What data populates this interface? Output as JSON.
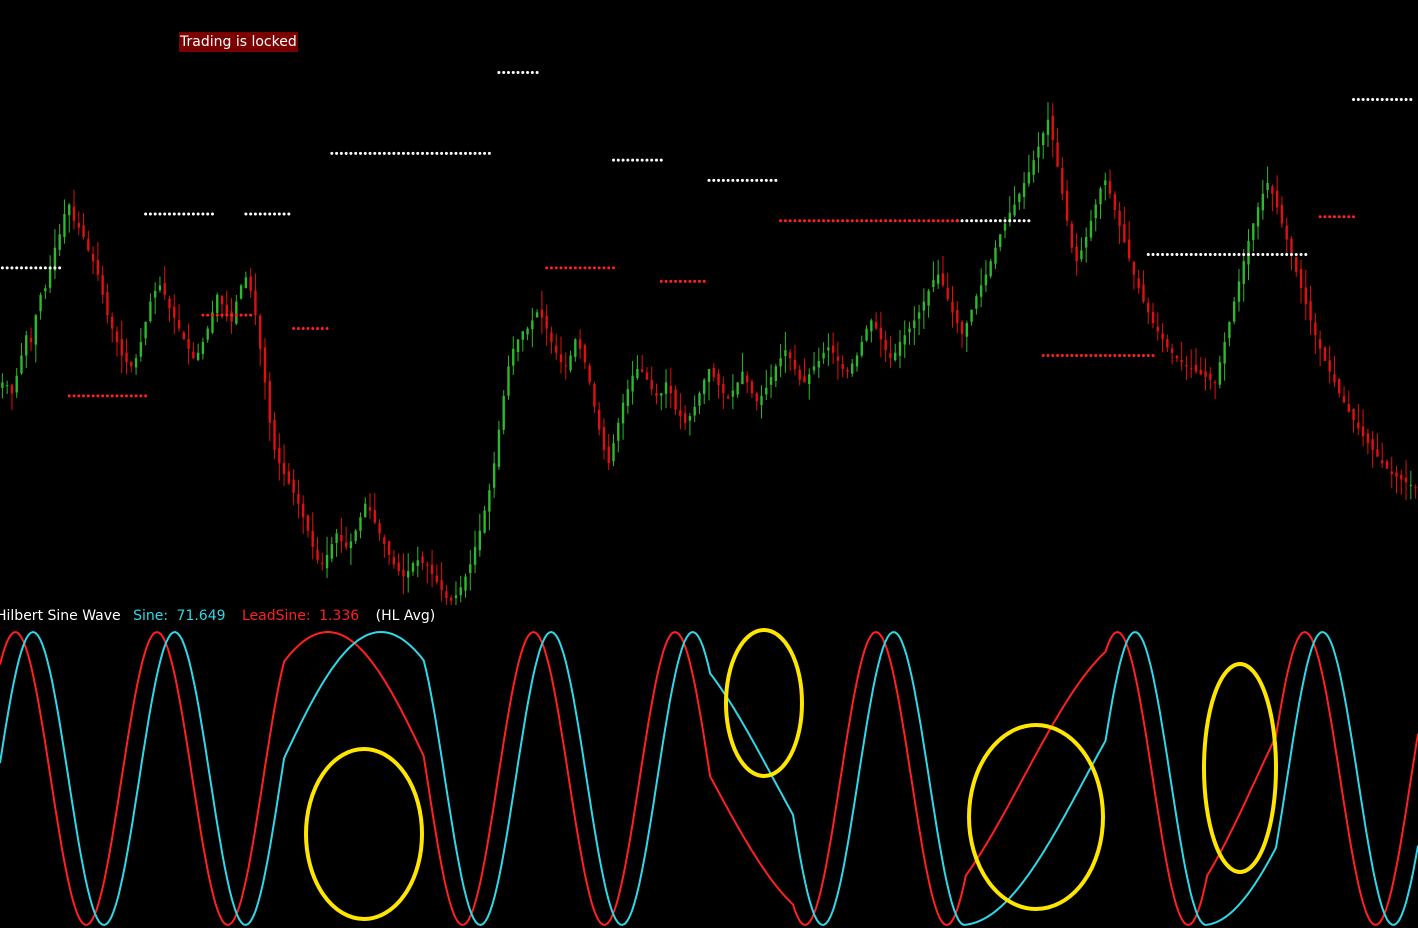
{
  "status": {
    "trading_lock": "Trading is locked"
  },
  "indicator": {
    "name": "Hilbert Sine Wave",
    "sine_label": "Sine:",
    "sine_value": "71.649",
    "leadsine_label": "LeadSine:",
    "leadsine_value": "1.336",
    "price_source": "(HL Avg)"
  },
  "colors": {
    "background": "#000000",
    "bull_candle": "#2db82d",
    "bear_candle": "#e01010",
    "resistance_dots": "#ffffff",
    "support_dots": "#ff2020",
    "sine_line": "#2fd8e8",
    "leadsine_line": "#ff2020",
    "highlight_circle": "#ffe600",
    "lock_label_bg": "#7a0000"
  },
  "chart_data": [
    {
      "type": "candlestick",
      "title": "",
      "description_series": "price path",
      "close": [
        380,
        378,
        372,
        385,
        400,
        415,
        410,
        430,
        445,
        450,
        465,
        480,
        490,
        505,
        512,
        500,
        495,
        488,
        478,
        470,
        460,
        445,
        430,
        420,
        410,
        400,
        395,
        392,
        398,
        410,
        425,
        440,
        448,
        452,
        445,
        435,
        428,
        420,
        412,
        405,
        398,
        402,
        410,
        420,
        432,
        445,
        438,
        430,
        425,
        440,
        452,
        458,
        448,
        430,
        405,
        380,
        350,
        330,
        320,
        312,
        305,
        298,
        290,
        280,
        270,
        258,
        248,
        245,
        252,
        260,
        268,
        262,
        258,
        262,
        270,
        280,
        290,
        285,
        276,
        268,
        260,
        252,
        245,
        240,
        236,
        240,
        246,
        248,
        246,
        244,
        238,
        232,
        226,
        220,
        218,
        222,
        228,
        236,
        245,
        258,
        270,
        285,
        300,
        320,
        345,
        370,
        392,
        405,
        412,
        418,
        420,
        426,
        432,
        428,
        420,
        410,
        402,
        395,
        392,
        400,
        412,
        405,
        395,
        380,
        362,
        345,
        330,
        320,
        335,
        350,
        365,
        375,
        385,
        390,
        388,
        382,
        375,
        370,
        372,
        380,
        372,
        360,
        355,
        350,
        355,
        362,
        372,
        382,
        390,
        384,
        378,
        372,
        368,
        374,
        380,
        388,
        380,
        372,
        366,
        370,
        376,
        384,
        392,
        398,
        404,
        398,
        390,
        382,
        380,
        386,
        392,
        396,
        402,
        406,
        402,
        396,
        390,
        388,
        394,
        400,
        410,
        420,
        426,
        420,
        412,
        404,
        398,
        402,
        410,
        415,
        420,
        426,
        432,
        440,
        448,
        456,
        460,
        452,
        442,
        432,
        424,
        416,
        424,
        434,
        444,
        452,
        460,
        470,
        480,
        490,
        498,
        506,
        512,
        520,
        528,
        536,
        545,
        555,
        565,
        575,
        560,
        540,
        520,
        500,
        480,
        470,
        478,
        488,
        500,
        512,
        524,
        530,
        520,
        508,
        496,
        484,
        472,
        460,
        450,
        440,
        432,
        424,
        418,
        412,
        406,
        402,
        398,
        395,
        392,
        390,
        388,
        386,
        384,
        382,
        380,
        395,
        410,
        425,
        440,
        455,
        470,
        485,
        498,
        510,
        520,
        528,
        520,
        510,
        498,
        486,
        474,
        462,
        450,
        438,
        426,
        415,
        405,
        396,
        388,
        380,
        372,
        365,
        358,
        352,
        346,
        340,
        335,
        330,
        325,
        320,
        316,
        312,
        310,
        308,
        306,
        304,
        302
      ],
      "resistance_levels": [
        {
          "from": 0,
          "to": 12,
          "value": 465
        },
        {
          "from": 30,
          "to": 44,
          "value": 505
        },
        {
          "from": 51,
          "to": 60,
          "value": 505
        },
        {
          "from": 69,
          "to": 102,
          "value": 550
        },
        {
          "from": 104,
          "to": 112,
          "value": 610
        },
        {
          "from": 128,
          "to": 138,
          "value": 545
        },
        {
          "from": 148,
          "to": 162,
          "value": 530
        },
        {
          "from": 200,
          "to": 215,
          "value": 500
        },
        {
          "from": 240,
          "to": 273,
          "value": 475
        },
        {
          "from": 283,
          "to": 295,
          "value": 590
        },
        {
          "from": 330,
          "to": 353,
          "value": 360
        }
      ],
      "support_levels": [
        {
          "from": 14,
          "to": 30,
          "value": 370
        },
        {
          "from": 42,
          "to": 52,
          "value": 430
        },
        {
          "from": 61,
          "to": 68,
          "value": 420
        },
        {
          "from": 114,
          "to": 128,
          "value": 465
        },
        {
          "from": 138,
          "to": 147,
          "value": 455
        },
        {
          "from": 163,
          "to": 200,
          "value": 500
        },
        {
          "from": 218,
          "to": 241,
          "value": 400
        },
        {
          "from": 276,
          "to": 283,
          "value": 503
        },
        {
          "from": 297,
          "to": 330,
          "value": 440
        }
      ]
    },
    {
      "type": "line",
      "title": "Hilbert Sine Wave",
      "series": [
        {
          "name": "Sine",
          "color": "#2fd8e8"
        },
        {
          "name": "LeadSine",
          "color": "#ff2020"
        }
      ],
      "highlights": 4
    }
  ]
}
